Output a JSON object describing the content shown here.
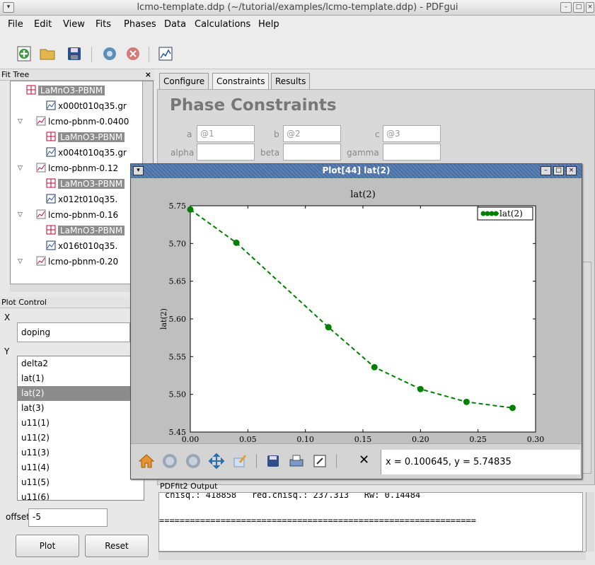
{
  "window": {
    "title": "lcmo-template.ddp (~/tutorial/examples/lcmo-template.ddp) - PDFgui",
    "menu_icon": "chevron-down-icon",
    "controls": [
      "–",
      "□",
      "×"
    ]
  },
  "menu": [
    "File",
    "Edit",
    "View",
    "Fits",
    "Phases",
    "Data",
    "Calculations",
    "Help"
  ],
  "toolbar": {
    "icons": [
      "new-fit-icon",
      "open-folder-icon",
      "save-icon",
      "run-icon",
      "stop-icon",
      "plot-icon"
    ]
  },
  "fit_tree": {
    "title": "Fit Tree",
    "close": "×",
    "rows": [
      {
        "label": "LaMnO3-PBNM",
        "type": "phase",
        "selected": true
      },
      {
        "label": "x000t010q35.gr",
        "type": "data"
      },
      {
        "label": "lcmo-pbnm-0.0400",
        "type": "fit",
        "expander": "▽"
      },
      {
        "label": "LaMnO3-PBNM",
        "type": "phase",
        "selected": true
      },
      {
        "label": "x004t010q35.gr",
        "type": "data"
      },
      {
        "label": "lcmo-pbnm-0.12",
        "type": "fit",
        "expander": "▽"
      },
      {
        "label": "LaMnO3-PBNM",
        "type": "phase",
        "selected": true
      },
      {
        "label": "x012t010q35.",
        "type": "data"
      },
      {
        "label": "lcmo-pbnm-0.16",
        "type": "fit",
        "expander": "▽"
      },
      {
        "label": "LaMnO3-PBNM",
        "type": "phase",
        "selected": true
      },
      {
        "label": "x016t010q35.",
        "type": "data"
      },
      {
        "label": "lcmo-pbnm-0.20",
        "type": "fit",
        "expander": "▽"
      }
    ]
  },
  "plot_control": {
    "title": "Plot Control",
    "x_label": "X",
    "x_value": "doping",
    "y_label": "Y",
    "y_items": [
      "delta2",
      "lat(1)",
      "lat(2)",
      "lat(3)",
      "u11(1)",
      "u11(2)",
      "u11(3)",
      "u11(4)",
      "u11(5)",
      "u11(6)"
    ],
    "y_selected": "lat(2)",
    "offset_label": "offset",
    "offset_value": "-5",
    "plot_button": "Plot",
    "reset_button": "Reset"
  },
  "tabs": [
    "Configure",
    "Constraints",
    "Results"
  ],
  "active_tab": "Constraints",
  "constraints": {
    "heading": "Phase Constraints",
    "fields": [
      {
        "label": "a",
        "value": "@1"
      },
      {
        "label": "b",
        "value": "@2"
      },
      {
        "label": "c",
        "value": "@3"
      },
      {
        "label": "alpha",
        "value": ""
      },
      {
        "label": "beta",
        "value": ""
      },
      {
        "label": "gamma",
        "value": ""
      }
    ]
  },
  "plot_window": {
    "title": "Plot[44] lat(2)",
    "coord_readout": "x = 0.100645, y = 5.74835",
    "tool_icons": [
      "home-icon",
      "back-icon",
      "forward-icon",
      "pan-icon",
      "edit-icon",
      "save-icon",
      "print-icon",
      "export-icon",
      "close-icon"
    ],
    "close_glyph": "✕"
  },
  "output": {
    "title": "PDFfit2 Output",
    "line1": "chisq.: 418858   red.chisq.: 237.313   Rw: 0.14484",
    "line2": "=============================================================="
  },
  "chart_data": {
    "type": "line",
    "title": "lat(2)",
    "xlabel": "doping",
    "ylabel": "lat(2)",
    "xlim": [
      0.0,
      0.3
    ],
    "ylim": [
      5.45,
      5.75
    ],
    "xticks": [
      "0.00",
      "0.05",
      "0.10",
      "0.15",
      "0.20",
      "0.25",
      "0.30"
    ],
    "yticks": [
      "5.45",
      "5.50",
      "5.55",
      "5.60",
      "5.65",
      "5.70",
      "5.75"
    ],
    "legend": "top-right",
    "series": [
      {
        "name": "lat(2)",
        "color": "#008000",
        "style": "dashed-with-markers",
        "x": [
          0.0,
          0.04,
          0.12,
          0.16,
          0.2,
          0.24,
          0.28
        ],
        "y": [
          5.745,
          5.701,
          5.589,
          5.536,
          5.507,
          5.49,
          5.482
        ]
      }
    ]
  }
}
